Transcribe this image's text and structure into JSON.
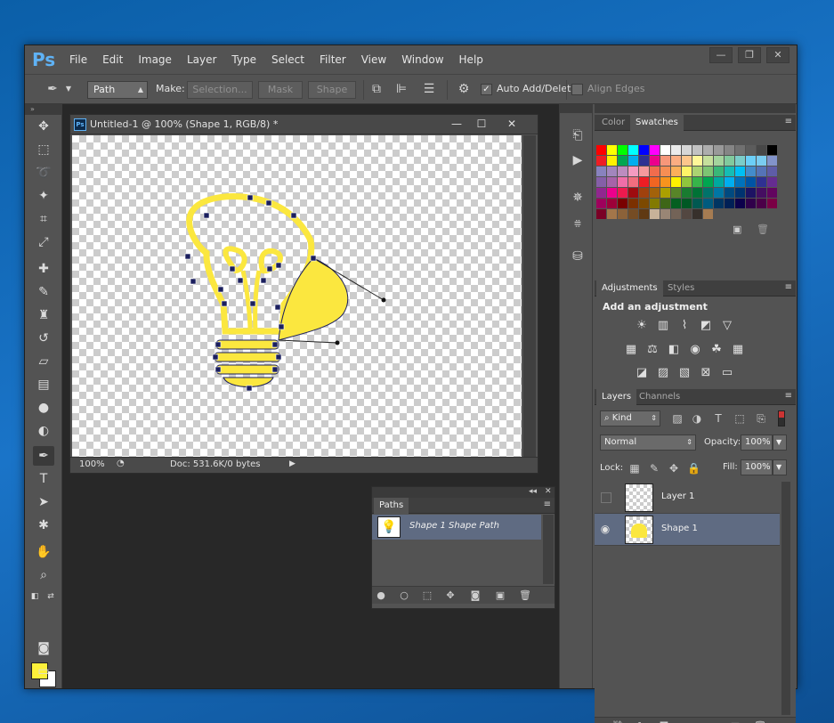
{
  "app": {
    "logo": "Ps",
    "menus": [
      "File",
      "Edit",
      "Image",
      "Layer",
      "Type",
      "Select",
      "Filter",
      "View",
      "Window",
      "Help"
    ],
    "window_controls": {
      "minimize": "—",
      "restore": "❐",
      "close": "✕"
    }
  },
  "options_bar": {
    "tool_mode": "Path",
    "make_label": "Make:",
    "selection_button": "Selection...",
    "mask_button": "Mask",
    "shape_button": "Shape",
    "auto_add_delete_label": "Auto Add/Delete",
    "auto_add_delete_checked": true,
    "align_edges_label": "Align Edges",
    "align_edges_checked": false
  },
  "tools": {
    "active_tool": "pen-tool",
    "foreground_color": "#fdf13a",
    "background_color": "#ffffff"
  },
  "document": {
    "title": "Untitled-1 @ 100% (Shape 1, RGB/8) *",
    "zoom": "100%",
    "doc_info": "Doc: 531.6K/0 bytes",
    "shape_fill_color": "#fbe73f",
    "anchor_color": "#1b1f5e"
  },
  "color_panel": {
    "tabs": [
      "Color",
      "Swatches"
    ],
    "active_tab": "Swatches"
  },
  "adjustments_panel": {
    "tabs": [
      "Adjustments",
      "Styles"
    ],
    "active_tab": "Adjustments",
    "title": "Add an adjustment"
  },
  "layers_panel": {
    "tabs": [
      "Layers",
      "Channels"
    ],
    "active_tab": "Layers",
    "filter": "Kind",
    "blend_mode": "Normal",
    "opacity_label": "Opacity:",
    "opacity": "100%",
    "lock_label": "Lock:",
    "fill_label": "Fill:",
    "fill": "100%",
    "layers": [
      {
        "name": "Layer 1",
        "visible": false,
        "selected": false
      },
      {
        "name": "Shape 1",
        "visible": true,
        "selected": true
      }
    ]
  },
  "paths_panel": {
    "tab": "Paths",
    "items": [
      {
        "name": "Shape 1 Shape Path",
        "selected": true
      }
    ]
  }
}
